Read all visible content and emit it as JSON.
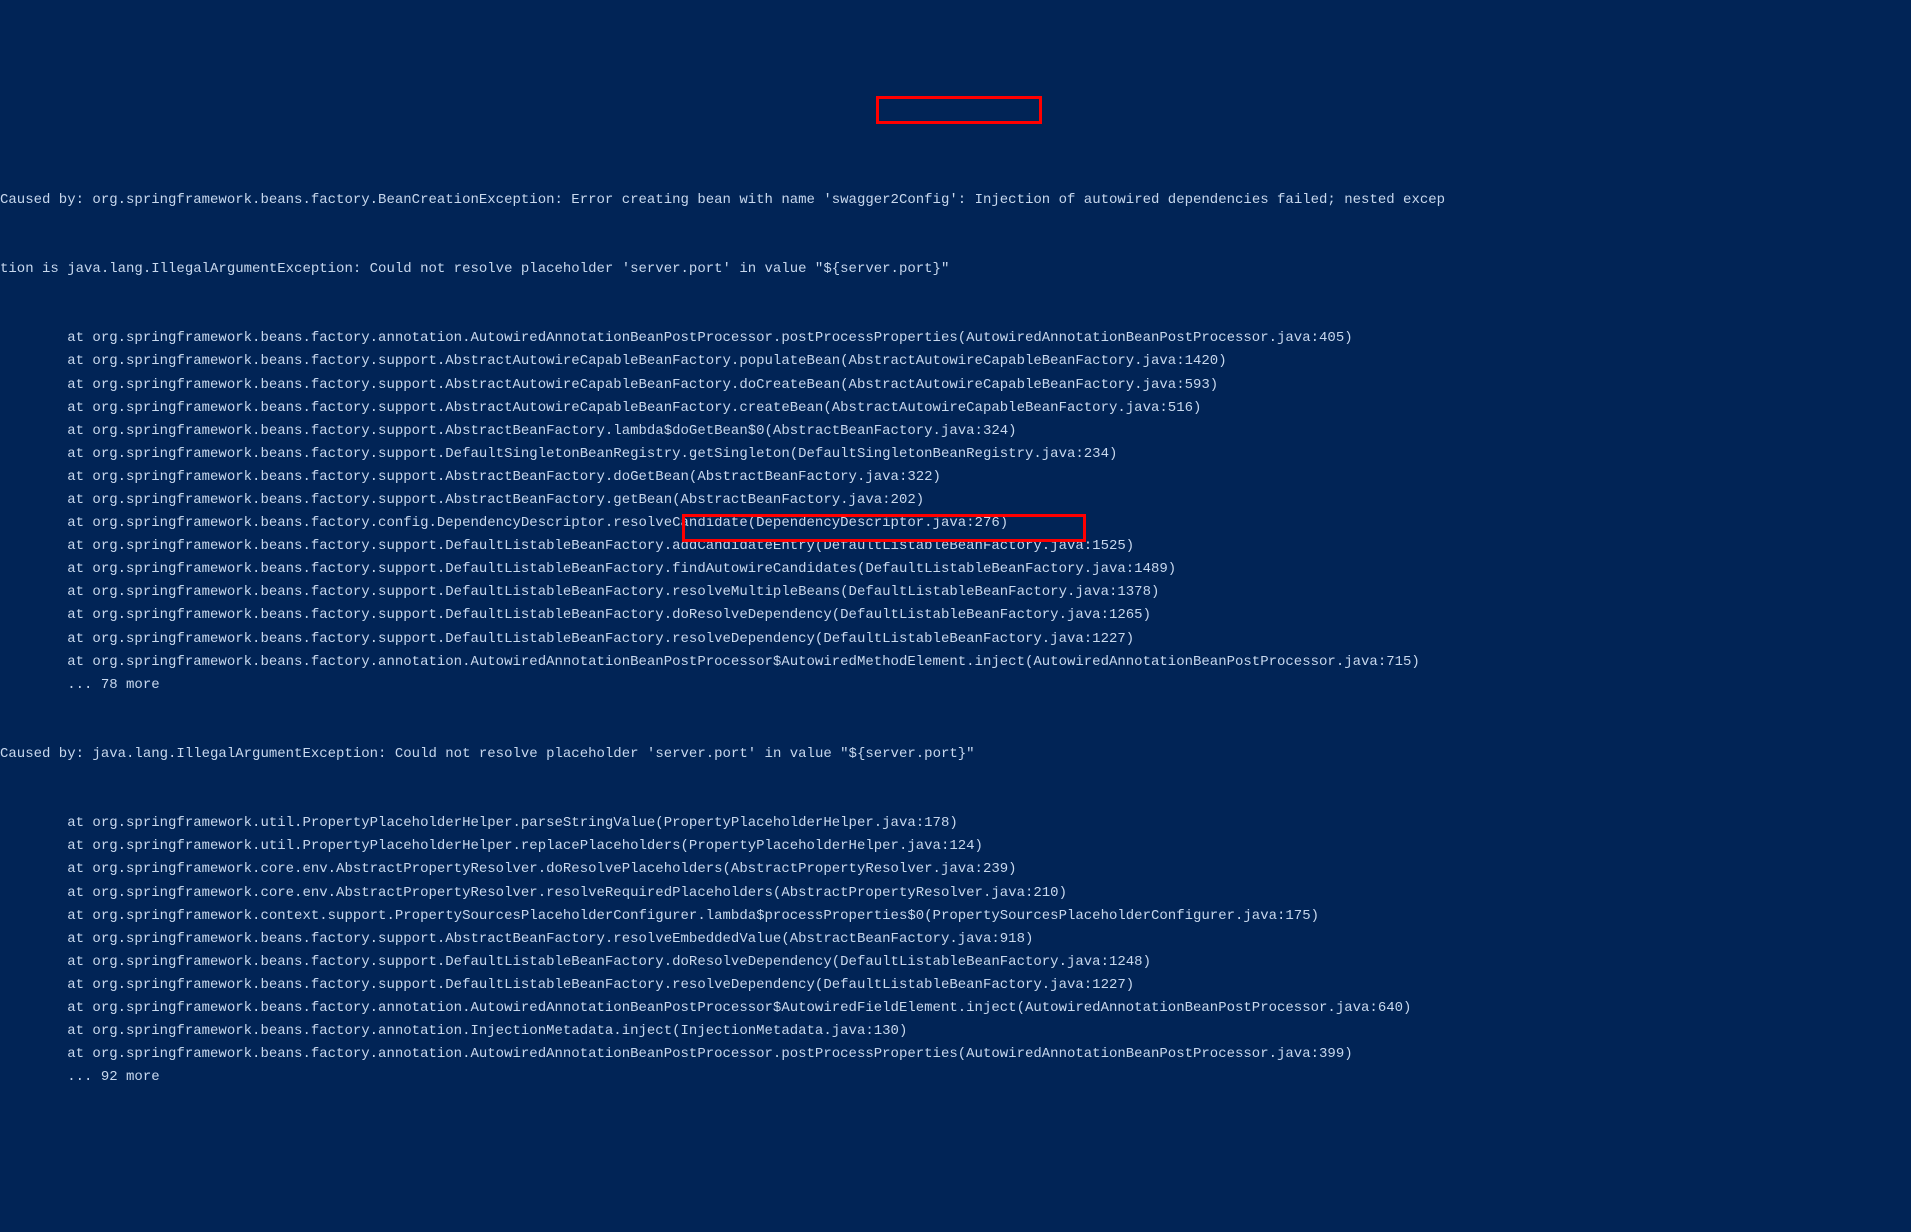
{
  "stacktrace": {
    "block1_header_part1": "Caused by: org.springframework.beans.factory.BeanCreationException: Error creating bean with name ",
    "block1_header_highlight": "'swagger2Config':",
    "block1_header_part2": " Injection of autowired dependencies failed; nested excep",
    "block1_wrap": "tion is java.lang.IllegalArgumentException: Could not resolve placeholder 'server.port' in value \"${server.port}\"",
    "block1_lines": [
      "        at org.springframework.beans.factory.annotation.AutowiredAnnotationBeanPostProcessor.postProcessProperties(AutowiredAnnotationBeanPostProcessor.java:405)",
      "        at org.springframework.beans.factory.support.AbstractAutowireCapableBeanFactory.populateBean(AbstractAutowireCapableBeanFactory.java:1420)",
      "        at org.springframework.beans.factory.support.AbstractAutowireCapableBeanFactory.doCreateBean(AbstractAutowireCapableBeanFactory.java:593)",
      "        at org.springframework.beans.factory.support.AbstractAutowireCapableBeanFactory.createBean(AbstractAutowireCapableBeanFactory.java:516)",
      "        at org.springframework.beans.factory.support.AbstractBeanFactory.lambda$doGetBean$0(AbstractBeanFactory.java:324)",
      "        at org.springframework.beans.factory.support.DefaultSingletonBeanRegistry.getSingleton(DefaultSingletonBeanRegistry.java:234)",
      "        at org.springframework.beans.factory.support.AbstractBeanFactory.doGetBean(AbstractBeanFactory.java:322)",
      "        at org.springframework.beans.factory.support.AbstractBeanFactory.getBean(AbstractBeanFactory.java:202)",
      "        at org.springframework.beans.factory.config.DependencyDescriptor.resolveCandidate(DependencyDescriptor.java:276)",
      "        at org.springframework.beans.factory.support.DefaultListableBeanFactory.addCandidateEntry(DefaultListableBeanFactory.java:1525)",
      "        at org.springframework.beans.factory.support.DefaultListableBeanFactory.findAutowireCandidates(DefaultListableBeanFactory.java:1489)",
      "        at org.springframework.beans.factory.support.DefaultListableBeanFactory.resolveMultipleBeans(DefaultListableBeanFactory.java:1378)",
      "        at org.springframework.beans.factory.support.DefaultListableBeanFactory.doResolveDependency(DefaultListableBeanFactory.java:1265)",
      "        at org.springframework.beans.factory.support.DefaultListableBeanFactory.resolveDependency(DefaultListableBeanFactory.java:1227)",
      "        at org.springframework.beans.factory.annotation.AutowiredAnnotationBeanPostProcessor$AutowiredMethodElement.inject(AutowiredAnnotationBeanPostProcessor.java:715)",
      "        ... 78 more"
    ],
    "block2_header_part1": "Caused by: java.lang.IllegalArgumentException: Could not resolve placeholder",
    "block2_header_highlight": " 'server.port' in value \"${server.port}\"",
    "block2_lines": [
      "        at org.springframework.util.PropertyPlaceholderHelper.parseStringValue(PropertyPlaceholderHelper.java:178)",
      "        at org.springframework.util.PropertyPlaceholderHelper.replacePlaceholders(PropertyPlaceholderHelper.java:124)",
      "        at org.springframework.core.env.AbstractPropertyResolver.doResolvePlaceholders(AbstractPropertyResolver.java:239)",
      "        at org.springframework.core.env.AbstractPropertyResolver.resolveRequiredPlaceholders(AbstractPropertyResolver.java:210)",
      "        at org.springframework.context.support.PropertySourcesPlaceholderConfigurer.lambda$processProperties$0(PropertySourcesPlaceholderConfigurer.java:175)",
      "        at org.springframework.beans.factory.support.AbstractBeanFactory.resolveEmbeddedValue(AbstractBeanFactory.java:918)",
      "        at org.springframework.beans.factory.support.DefaultListableBeanFactory.doResolveDependency(DefaultListableBeanFactory.java:1248)",
      "        at org.springframework.beans.factory.support.DefaultListableBeanFactory.resolveDependency(DefaultListableBeanFactory.java:1227)",
      "        at org.springframework.beans.factory.annotation.AutowiredAnnotationBeanPostProcessor$AutowiredFieldElement.inject(AutowiredAnnotationBeanPostProcessor.java:640)",
      "        at org.springframework.beans.factory.annotation.InjectionMetadata.inject(InjectionMetadata.java:130)",
      "        at org.springframework.beans.factory.annotation.AutowiredAnnotationBeanPostProcessor.postProcessProperties(AutowiredAnnotationBeanPostProcessor.java:399)",
      "        ... 92 more"
    ]
  }
}
